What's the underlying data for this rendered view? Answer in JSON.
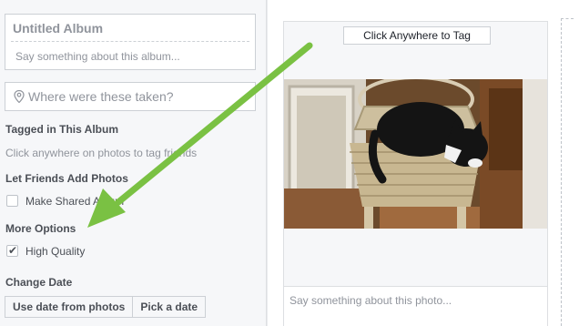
{
  "album": {
    "title_placeholder": "Untitled Album",
    "description_placeholder": "Say something about this album..."
  },
  "location": {
    "placeholder": "Where were these taken?",
    "icon": "pin-icon"
  },
  "tagging": {
    "heading": "Tagged in This Album",
    "hint": "Click anywhere on photos to tag friends"
  },
  "friends": {
    "heading": "Let Friends Add Photos",
    "checkbox_label": "Make Shared Album",
    "checked": false
  },
  "options": {
    "heading": "More Options",
    "checkbox_label": "High Quality",
    "checked": true
  },
  "date": {
    "heading": "Change Date",
    "use_photos_label": "Use date from photos",
    "pick_label": "Pick a date"
  },
  "photo": {
    "tag_button": "Click Anywhere to Tag",
    "caption_placeholder": "Say something about this photo..."
  },
  "annotation": {
    "arrow_color": "#7ac143"
  }
}
